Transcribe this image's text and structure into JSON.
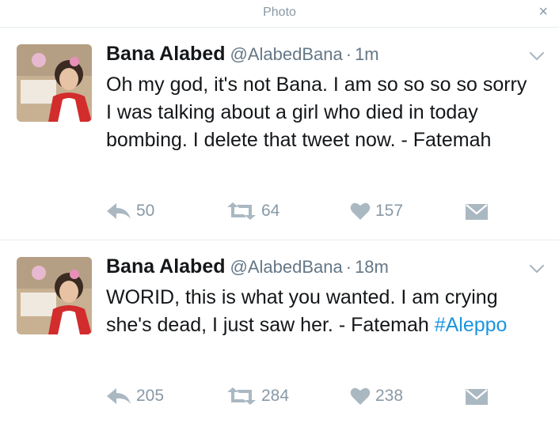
{
  "header": {
    "title": "Photo",
    "close_glyph": "×"
  },
  "tweets": [
    {
      "name": "Bana Alabed",
      "handle": "@AlabedBana",
      "separator": "·",
      "time": "1m",
      "text": "Oh my god, it's not Bana. I am so so so so sorry I was talking about a girl who died in today bombing. I delete that tweet now. - Fatemah",
      "hashtag": "",
      "replies": "50",
      "retweets": "64",
      "likes": "157"
    },
    {
      "name": "Bana Alabed",
      "handle": "@AlabedBana",
      "separator": "·",
      "time": "18m",
      "text": "WORID, this is what you wanted. I am crying she's dead, I just saw her. - Fatemah ",
      "hashtag": "#Aleppo",
      "replies": "205",
      "retweets": "284",
      "likes": "238"
    }
  ],
  "icons": {
    "reply": "reply-icon",
    "retweet": "retweet-icon",
    "like": "heart-icon",
    "dm": "envelope-icon",
    "caret": "chevron-down-icon",
    "close": "close-icon"
  },
  "colors": {
    "icon_gray": "#aab8c2",
    "meta_gray": "#657786",
    "hashtag_blue": "#1b95e0",
    "divider": "#e6ecf0"
  }
}
